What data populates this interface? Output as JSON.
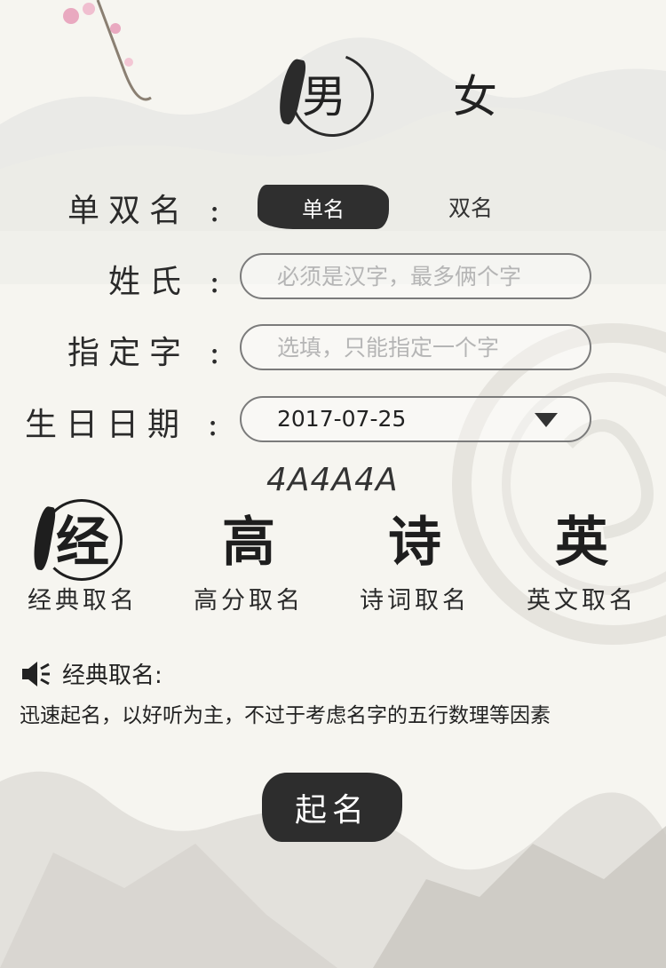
{
  "gender": {
    "male": "男",
    "female": "女",
    "selected": "male"
  },
  "form": {
    "name_type_label": "单双名",
    "name_type_options": {
      "single": "单名",
      "double": "双名"
    },
    "surname_label": "姓氏",
    "surname_placeholder": "必须是汉字，最多俩个字",
    "specified_label": "指定字",
    "specified_placeholder": "选填，只能指定一个字",
    "birth_label": "生日日期",
    "birth_value": "2017-07-25",
    "colon": ":"
  },
  "captcha": "4A4A4A",
  "methods": [
    {
      "glyph": "经",
      "label": "经典取名",
      "selected": true
    },
    {
      "glyph": "高",
      "label": "高分取名"
    },
    {
      "glyph": "诗",
      "label": "诗词取名"
    },
    {
      "glyph": "英",
      "label": "英文取名"
    }
  ],
  "description": {
    "title": "经典取名:",
    "text": "迅速起名，以好听为主，不过于考虑名字的五行数理等因素"
  },
  "submit_label": "起名"
}
